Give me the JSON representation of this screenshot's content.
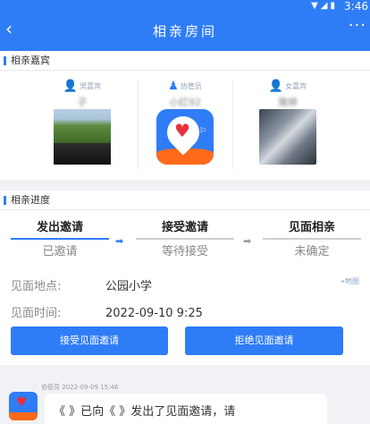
{
  "status_bar": {
    "time": "3:46"
  },
  "header": {
    "title": "相亲房间",
    "back_icon": "chevron-left-icon",
    "more_icon": "more-dots-icon"
  },
  "guests_section": {
    "title": "相亲嘉宾",
    "guests": [
      {
        "role": "男嘉宾",
        "name": "子",
        "photo": "landscape-photo"
      },
      {
        "role": "协管员",
        "name": "小红92",
        "photo": "app-logo"
      },
      {
        "role": "女嘉宾",
        "name": "雅婷",
        "photo": "city-photo"
      }
    ]
  },
  "progress_section": {
    "title": "相亲进度",
    "steps": [
      {
        "title": "发出邀请",
        "status": "已邀请"
      },
      {
        "title": "接受邀请",
        "status": "等待接受"
      },
      {
        "title": "见面相亲",
        "status": "未确定"
      }
    ],
    "location_label": "见面地点:",
    "location_value": "公园小学",
    "map_label": "地图",
    "time_label": "见面时间:",
    "time_value": "2022-09-10 9:25"
  },
  "actions": {
    "accept": "接受见面邀请",
    "reject": "拒绝见面邀请"
  },
  "chat": {
    "sender": "协管员",
    "timestamp": "2022-09-09 15:46",
    "message": "《     》已向《      》发出了见面邀请，请"
  },
  "colors": {
    "accent": "#2f7df6",
    "brand_orange": "#ff6a1a"
  }
}
